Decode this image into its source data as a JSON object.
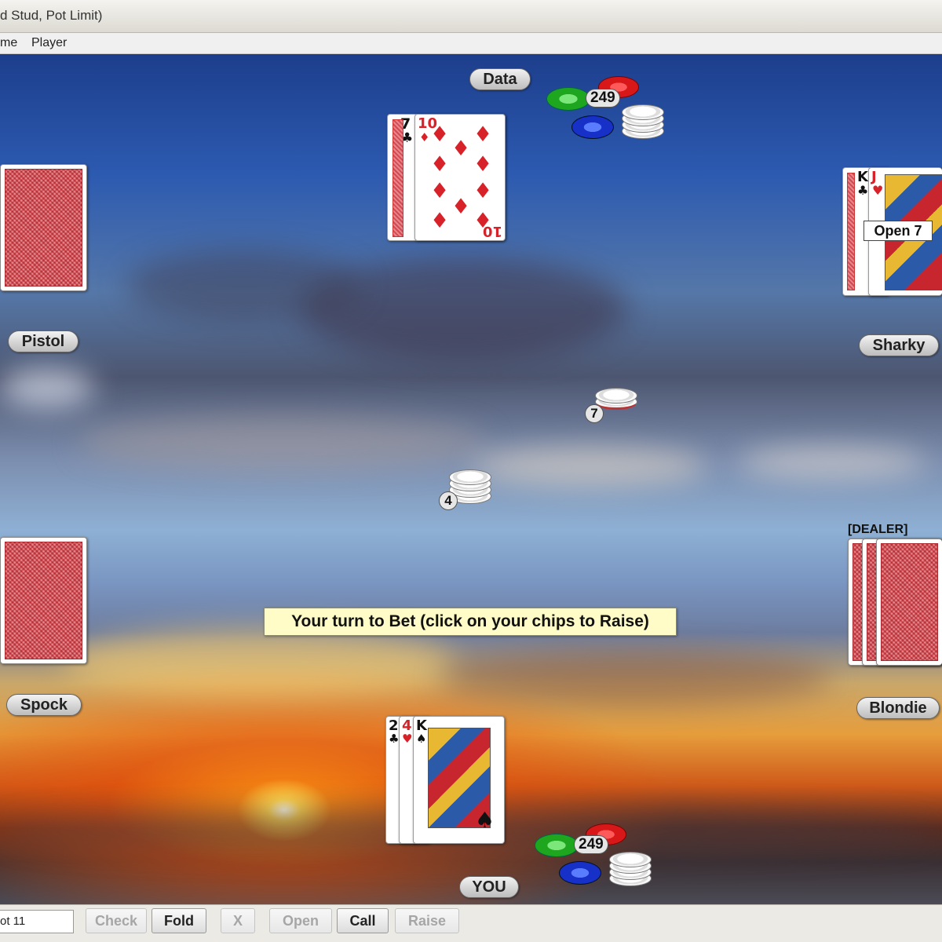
{
  "window": {
    "title": "d Stud, Pot Limit)"
  },
  "menu": {
    "items": [
      "me",
      "Player"
    ]
  },
  "players": {
    "data": {
      "name": "Data",
      "chips": "249"
    },
    "pistol": {
      "name": "Pistol"
    },
    "sharky": {
      "name": "Sharky",
      "action": "Open 7"
    },
    "spock": {
      "name": "Spock"
    },
    "blondie": {
      "name": "Blondie",
      "tag": "[DEALER]"
    },
    "you": {
      "name": "YOU",
      "chips": "249"
    }
  },
  "cards": {
    "data": [
      {
        "rank": "7",
        "suit": "♣",
        "color": "black"
      },
      {
        "rank": "10",
        "suit": "♦",
        "color": "red"
      }
    ],
    "sharky": [
      {
        "rank": "K",
        "suit": "♣",
        "color": "black"
      },
      {
        "rank": "J",
        "suit": "♥",
        "color": "red"
      }
    ],
    "you": [
      {
        "rank": "2",
        "suit": "♣",
        "color": "black"
      },
      {
        "rank": "4",
        "suit": "♥",
        "color": "red"
      },
      {
        "rank": "K",
        "suit": "♠",
        "color": "black"
      }
    ]
  },
  "bets": {
    "sharky": "7",
    "you": "4"
  },
  "message": "Your turn to Bet (click on your chips to Raise)",
  "statusbar": {
    "text": "ot 11"
  },
  "actions": {
    "check": "Check",
    "fold": "Fold",
    "x": "X",
    "open": "Open",
    "call": "Call",
    "raise": "Raise"
  },
  "colors": {
    "chip_green": "#2fb52f",
    "chip_red": "#e01f1f",
    "chip_blue": "#1a3ccc",
    "message_bg": "#fffcc8"
  }
}
